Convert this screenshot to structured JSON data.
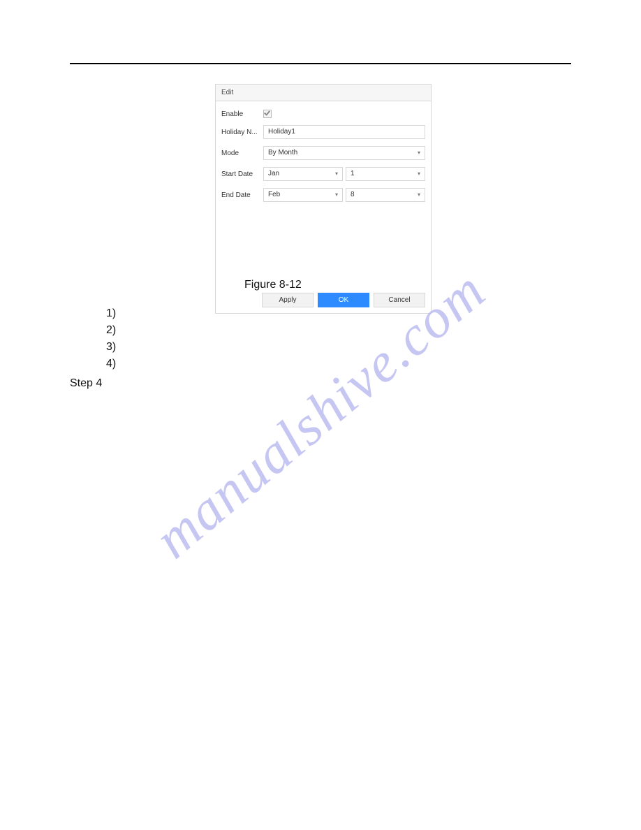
{
  "watermark": "manualshive.com",
  "dialog": {
    "title": "Edit",
    "labels": {
      "enable": "Enable",
      "holiday_name": "Holiday N...",
      "mode": "Mode",
      "start_date": "Start Date",
      "end_date": "End Date"
    },
    "values": {
      "holiday_name": "Holiday1",
      "mode": "By Month",
      "start_month": "Jan",
      "start_day": "1",
      "end_month": "Feb",
      "end_day": "8"
    },
    "buttons": {
      "apply": "Apply",
      "ok": "OK",
      "cancel": "Cancel"
    }
  },
  "caption": "Figure 8-12",
  "list": [
    "1)",
    "2)",
    "3)",
    "4)"
  ],
  "step": "Step 4"
}
